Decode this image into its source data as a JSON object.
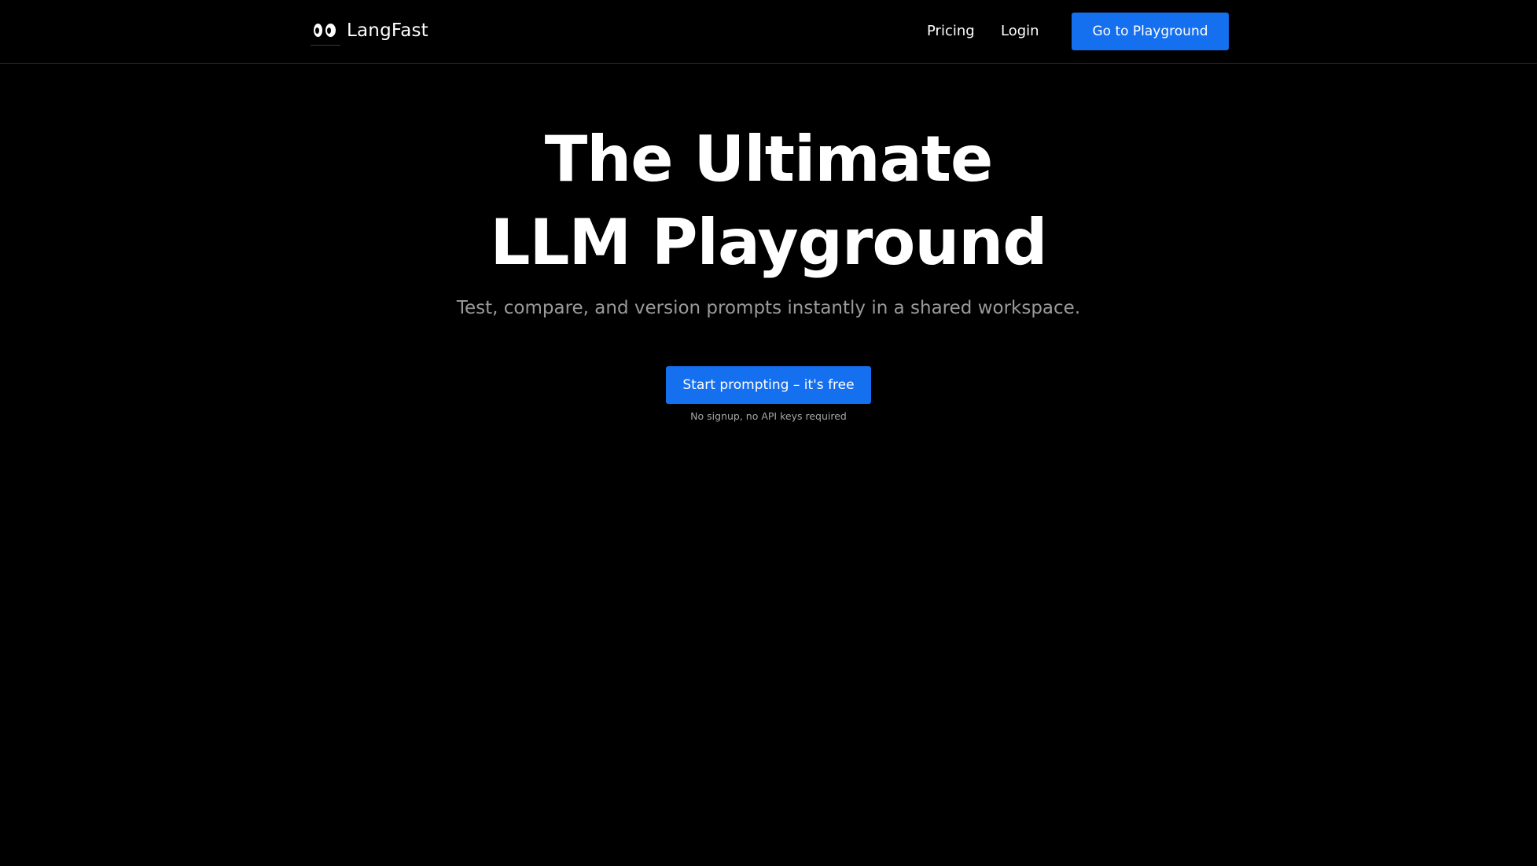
{
  "header": {
    "brand_name": "LangFast",
    "logo_icon": "eyes-logo-icon",
    "nav": {
      "pricing_label": "Pricing",
      "login_label": "Login"
    },
    "cta_label": "Go to Playground"
  },
  "hero": {
    "title_line1": "The Ultimate",
    "title_line2": "LLM Playground",
    "subtitle": "Test, compare, and version prompts instantly in a shared workspace.",
    "cta_label": "Start prompting – it's free",
    "cta_note": "No signup, no API keys required"
  },
  "colors": {
    "background": "#000000",
    "accent": "#1570ef",
    "muted_text": "#9a9a9a"
  }
}
